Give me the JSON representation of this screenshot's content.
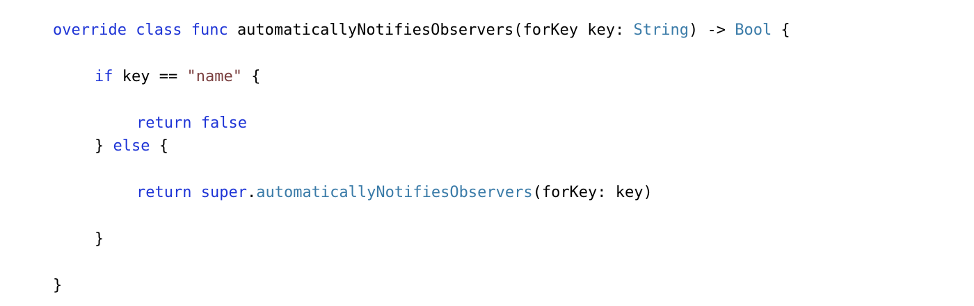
{
  "code": {
    "line1": {
      "override": "override",
      "class": "class",
      "func": "func",
      "signature_start": "automaticallyNotifiesObservers(forKey key: ",
      "param_type": "String",
      "arrow": ") -> ",
      "return_type": "Bool",
      "open_brace": " {"
    },
    "line2": {
      "if": "if",
      "condition_start": "key == ",
      "string_literal": "\"name\"",
      "open_brace": " {"
    },
    "line3": {
      "return": "return",
      "false": "false"
    },
    "line4": {
      "close_brace": "} ",
      "else": "else",
      "open_brace": " {"
    },
    "line5": {
      "return": "return",
      "super": "super",
      "dot": ".",
      "method": "automaticallyNotifiesObservers",
      "args": "(forKey: key)"
    },
    "line6": {
      "close_brace": "}"
    },
    "line7": {
      "close_brace": "}"
    }
  },
  "colors": {
    "keyword": "#1f35d6",
    "type": "#3a7ba8",
    "string": "#7a3f3f",
    "plain": "#000000",
    "background": "#ffffff"
  }
}
